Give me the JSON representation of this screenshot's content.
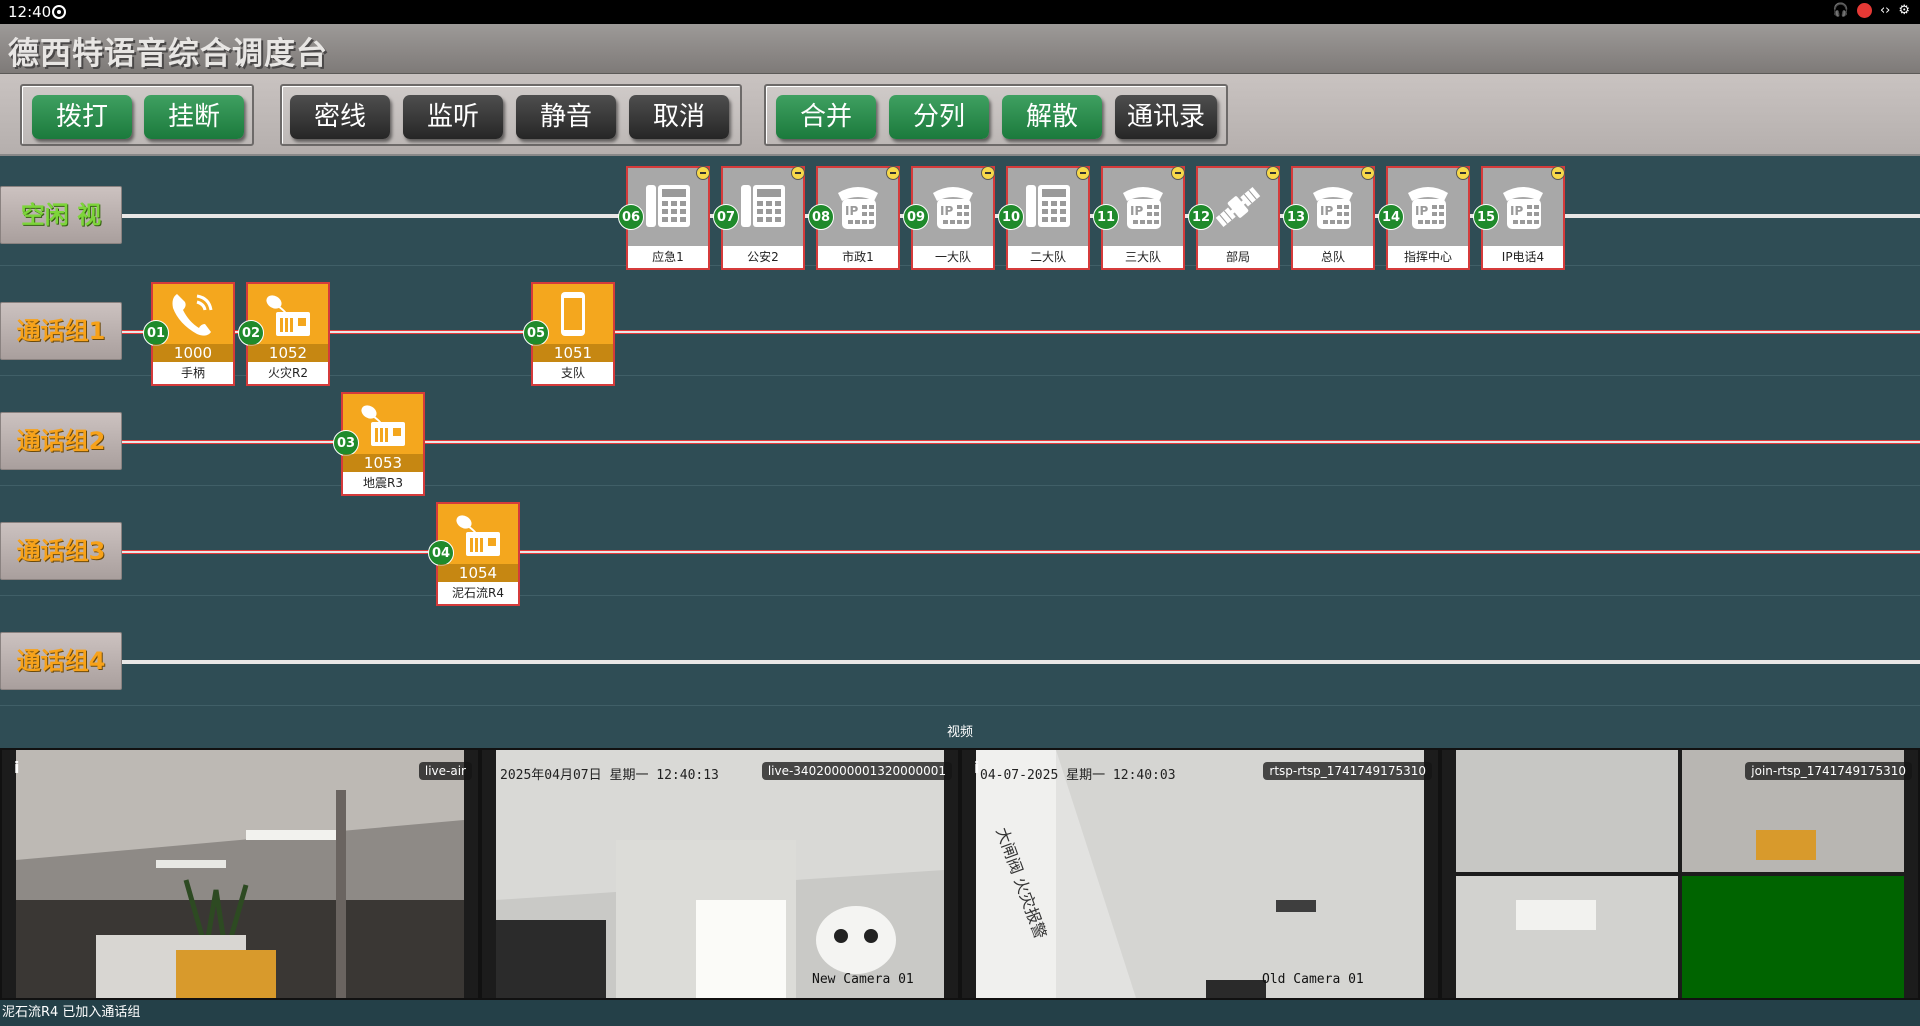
{
  "statusbar": {
    "time": "12:40",
    "right_icons": [
      "headphones-icon",
      "record-icon",
      "code-icon",
      "settings-icon"
    ]
  },
  "app": {
    "title": "德西特语音综合调度台"
  },
  "toolbar": {
    "group1": [
      "拨打",
      "挂断"
    ],
    "group2": [
      "密线",
      "监听",
      "静音",
      "取消"
    ],
    "group3": [
      "合并",
      "分列",
      "解散",
      "通讯录"
    ]
  },
  "groups": [
    "空闲 视",
    "通话组1",
    "通话组2",
    "通话组3",
    "通话组4"
  ],
  "idle_terminals": [
    {
      "num": "06",
      "name": "应急1",
      "icon": "desk-phone-icon"
    },
    {
      "num": "07",
      "name": "公安2",
      "icon": "desk-phone-icon"
    },
    {
      "num": "08",
      "name": "市政1",
      "icon": "ip-phone-icon"
    },
    {
      "num": "09",
      "name": "一大队",
      "icon": "ip-phone-icon"
    },
    {
      "num": "10",
      "name": "二大队",
      "icon": "desk-phone-icon"
    },
    {
      "num": "11",
      "name": "三大队",
      "icon": "ip-phone-icon"
    },
    {
      "num": "12",
      "name": "部局",
      "icon": "satellite-icon"
    },
    {
      "num": "13",
      "name": "总队",
      "icon": "ip-phone-icon"
    },
    {
      "num": "14",
      "name": "指挥中心",
      "icon": "ip-phone-icon"
    },
    {
      "num": "15",
      "name": "IP电话4",
      "icon": "ip-phone-icon"
    }
  ],
  "call_terminals": [
    {
      "num": "01",
      "ext": "1000",
      "name": "手柄",
      "icon": "handset-icon"
    },
    {
      "num": "02",
      "ext": "1052",
      "name": "火灾R2",
      "icon": "radio-icon"
    },
    {
      "num": "05",
      "ext": "1051",
      "name": "支队",
      "icon": "mobile-phone-icon"
    },
    {
      "num": "03",
      "ext": "1053",
      "name": "地震R3",
      "icon": "radio-icon"
    },
    {
      "num": "04",
      "ext": "1054",
      "name": "泥石流R4",
      "icon": "radio-icon"
    }
  ],
  "video": {
    "label": "视频",
    "feeds": [
      {
        "tag": "live-air",
        "info": "i",
        "osd": "",
        "camname": ""
      },
      {
        "tag": "live-34020000001320000001",
        "info": "i",
        "osd": "2025年04月07日 星期一 12:40:13",
        "camname": "New Camera 01"
      },
      {
        "tag": "rtsp-rtsp_1741749175310",
        "info": "i",
        "osd": "04-07-2025 星期一 12:40:03",
        "camname": "Old Camera 01"
      },
      {
        "tag": "join-rtsp_1741749175310",
        "info": "i",
        "osd": "",
        "camname": ""
      }
    ]
  },
  "status_message": "泥石流R4 已加入通话组"
}
